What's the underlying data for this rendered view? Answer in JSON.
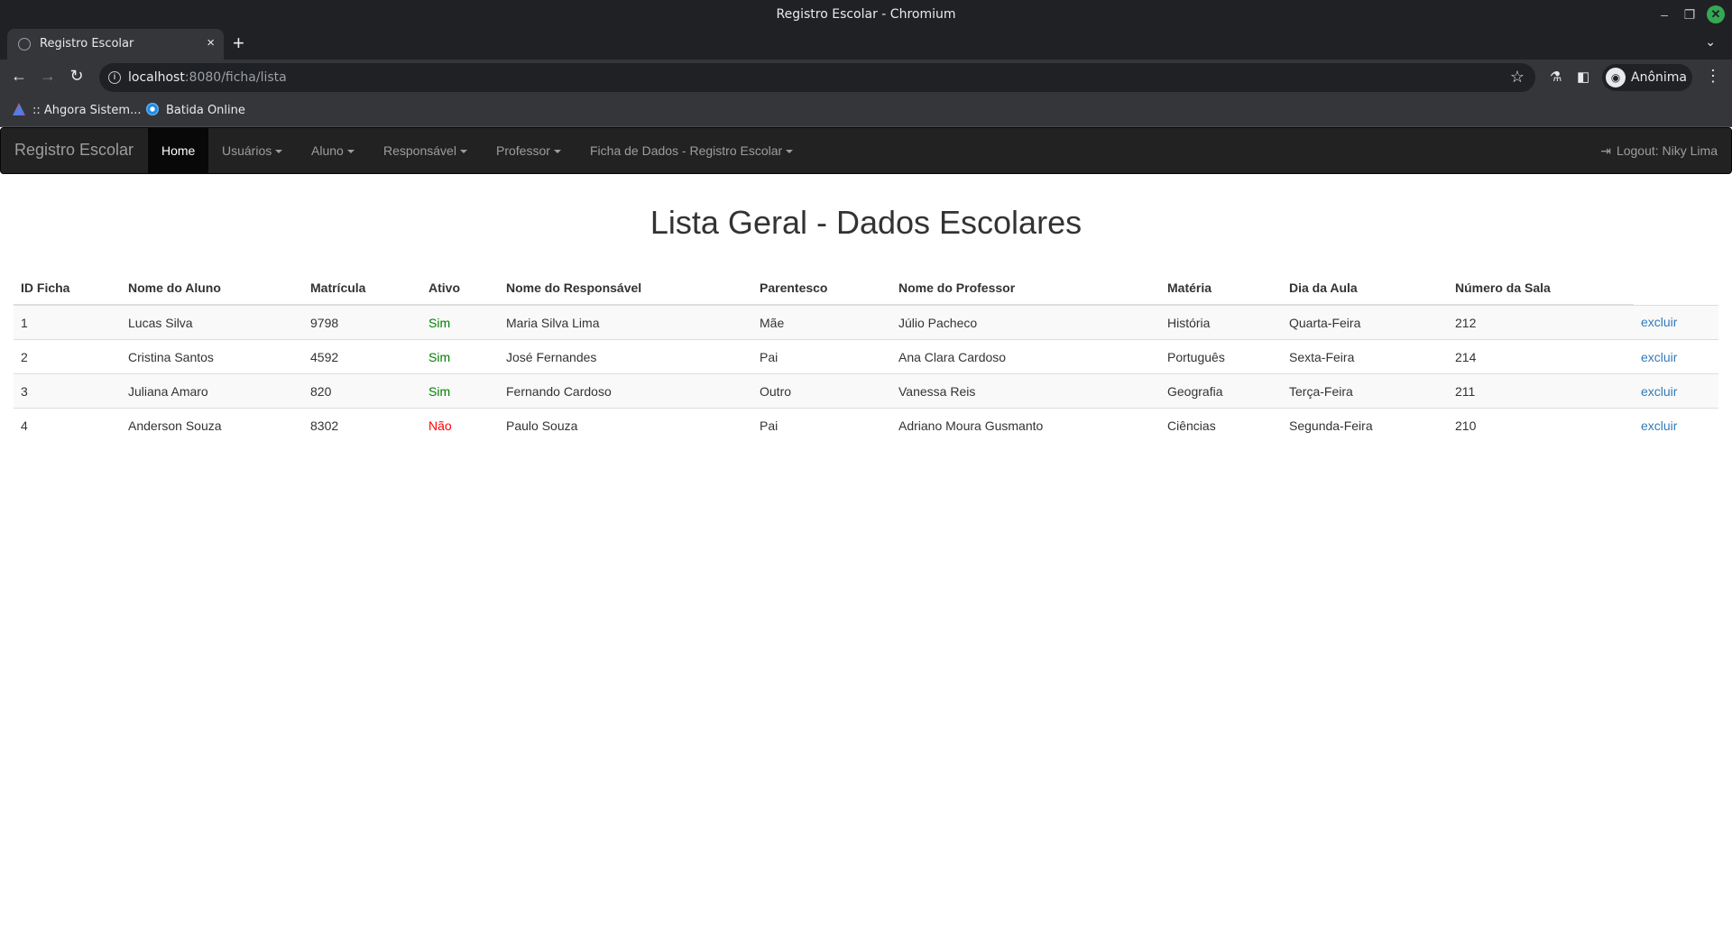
{
  "window": {
    "title": "Registro Escolar - Chromium"
  },
  "tab": {
    "title": "Registro Escolar",
    "close": "×",
    "new_tab": "+"
  },
  "address_bar": {
    "host": "localhost",
    "rest": ":8080/ficha/lista"
  },
  "profile": {
    "name": "Anônima"
  },
  "bookmarks": [
    {
      "label": ":: Ahgora Sistem..."
    },
    {
      "label": "Batida Online"
    }
  ],
  "navbar": {
    "brand": "Registro Escolar",
    "items": [
      {
        "label": "Home",
        "dropdown": false
      },
      {
        "label": "Usuários",
        "dropdown": true
      },
      {
        "label": "Aluno",
        "dropdown": true
      },
      {
        "label": "Responsável",
        "dropdown": true
      },
      {
        "label": "Professor",
        "dropdown": true
      },
      {
        "label": "Ficha de Dados - Registro Escolar",
        "dropdown": true
      }
    ],
    "logout": "Logout: Niky Lima"
  },
  "main": {
    "title": "Lista Geral - Dados Escolares",
    "columns": [
      "ID Ficha",
      "Nome do Aluno",
      "Matrícula",
      "Ativo",
      "Nome do Responsável",
      "Parentesco",
      "Nome do Professor",
      "Matéria",
      "Dia da Aula",
      "Número da Sala",
      ""
    ],
    "rows": [
      {
        "id": "1",
        "aluno": "Lucas Silva",
        "matricula": "9798",
        "ativo": "Sim",
        "responsavel": "Maria Silva Lima",
        "parentesco": "Mãe",
        "professor": "Júlio Pacheco",
        "materia": "História",
        "dia": "Quarta-Feira",
        "sala": "212",
        "acao": "excluir"
      },
      {
        "id": "2",
        "aluno": "Cristina Santos",
        "matricula": "4592",
        "ativo": "Sim",
        "responsavel": "José Fernandes",
        "parentesco": "Pai",
        "professor": "Ana Clara Cardoso",
        "materia": "Português",
        "dia": "Sexta-Feira",
        "sala": "214",
        "acao": "excluir"
      },
      {
        "id": "3",
        "aluno": "Juliana Amaro",
        "matricula": "820",
        "ativo": "Sim",
        "responsavel": "Fernando Cardoso",
        "parentesco": "Outro",
        "professor": "Vanessa Reis",
        "materia": "Geografia",
        "dia": "Terça-Feira",
        "sala": "211",
        "acao": "excluir"
      },
      {
        "id": "4",
        "aluno": "Anderson Souza",
        "matricula": "8302",
        "ativo": "Não",
        "responsavel": "Paulo Souza",
        "parentesco": "Pai",
        "professor": "Adriano Moura Gusmanto",
        "materia": "Ciências",
        "dia": "Segunda-Feira",
        "sala": "210",
        "acao": "excluir"
      }
    ]
  },
  "colors": {
    "navbar_bg": "#222222",
    "active_green": "#008000",
    "inactive_red": "#ff0000",
    "link_blue": "#337ab7"
  }
}
